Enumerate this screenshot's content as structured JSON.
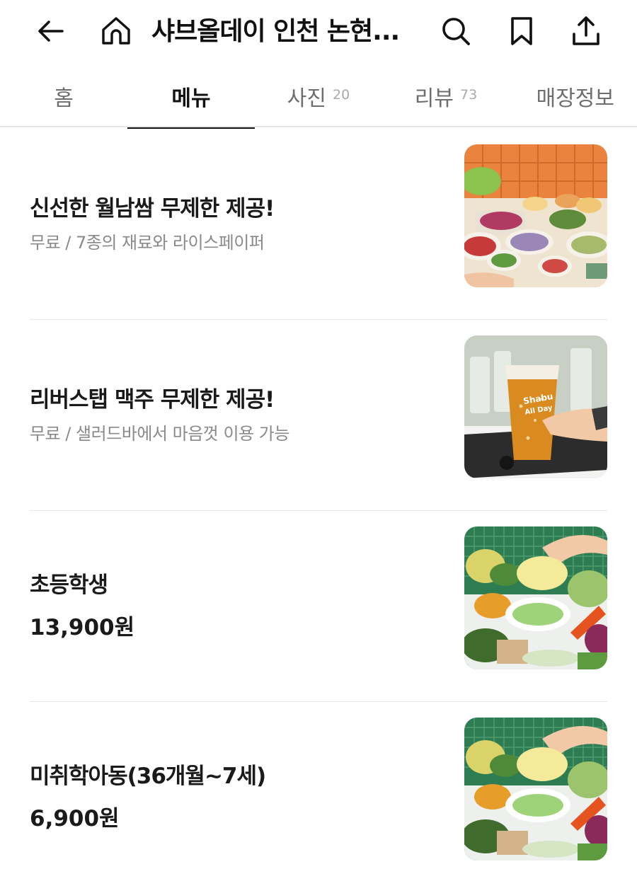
{
  "header": {
    "title": "샤브올데이 인천 논현...",
    "back_icon": "arrow-left-icon",
    "home_icon": "home-icon",
    "search_icon": "search-icon",
    "bookmark_icon": "bookmark-icon",
    "share_icon": "share-icon"
  },
  "tabs": [
    {
      "label": "홈",
      "count": ""
    },
    {
      "label": "메뉴",
      "count": ""
    },
    {
      "label": "사진",
      "count": "20"
    },
    {
      "label": "리뷰",
      "count": "73"
    },
    {
      "label": "매장정보",
      "count": ""
    }
  ],
  "active_tab": "메뉴",
  "menu_items": [
    {
      "name": "신선한 월남쌈 무제한 제공!",
      "description": "무료 / 7종의 재료와 라이스페이퍼",
      "price": ""
    },
    {
      "name": "리버스탭 맥주 무제한 제공!",
      "description": "무료 / 샐러드바에서 마음껏 이용 가능",
      "price": ""
    },
    {
      "name": "초등학생",
      "description": "",
      "price": "13,900원"
    },
    {
      "name": "미취학아동(36개월~7세)",
      "description": "",
      "price": "6,900원"
    }
  ],
  "colors": {
    "text": "#111111",
    "muted": "#8a8a8a",
    "divider": "#e8e8e8",
    "active_underline": "#111111"
  }
}
